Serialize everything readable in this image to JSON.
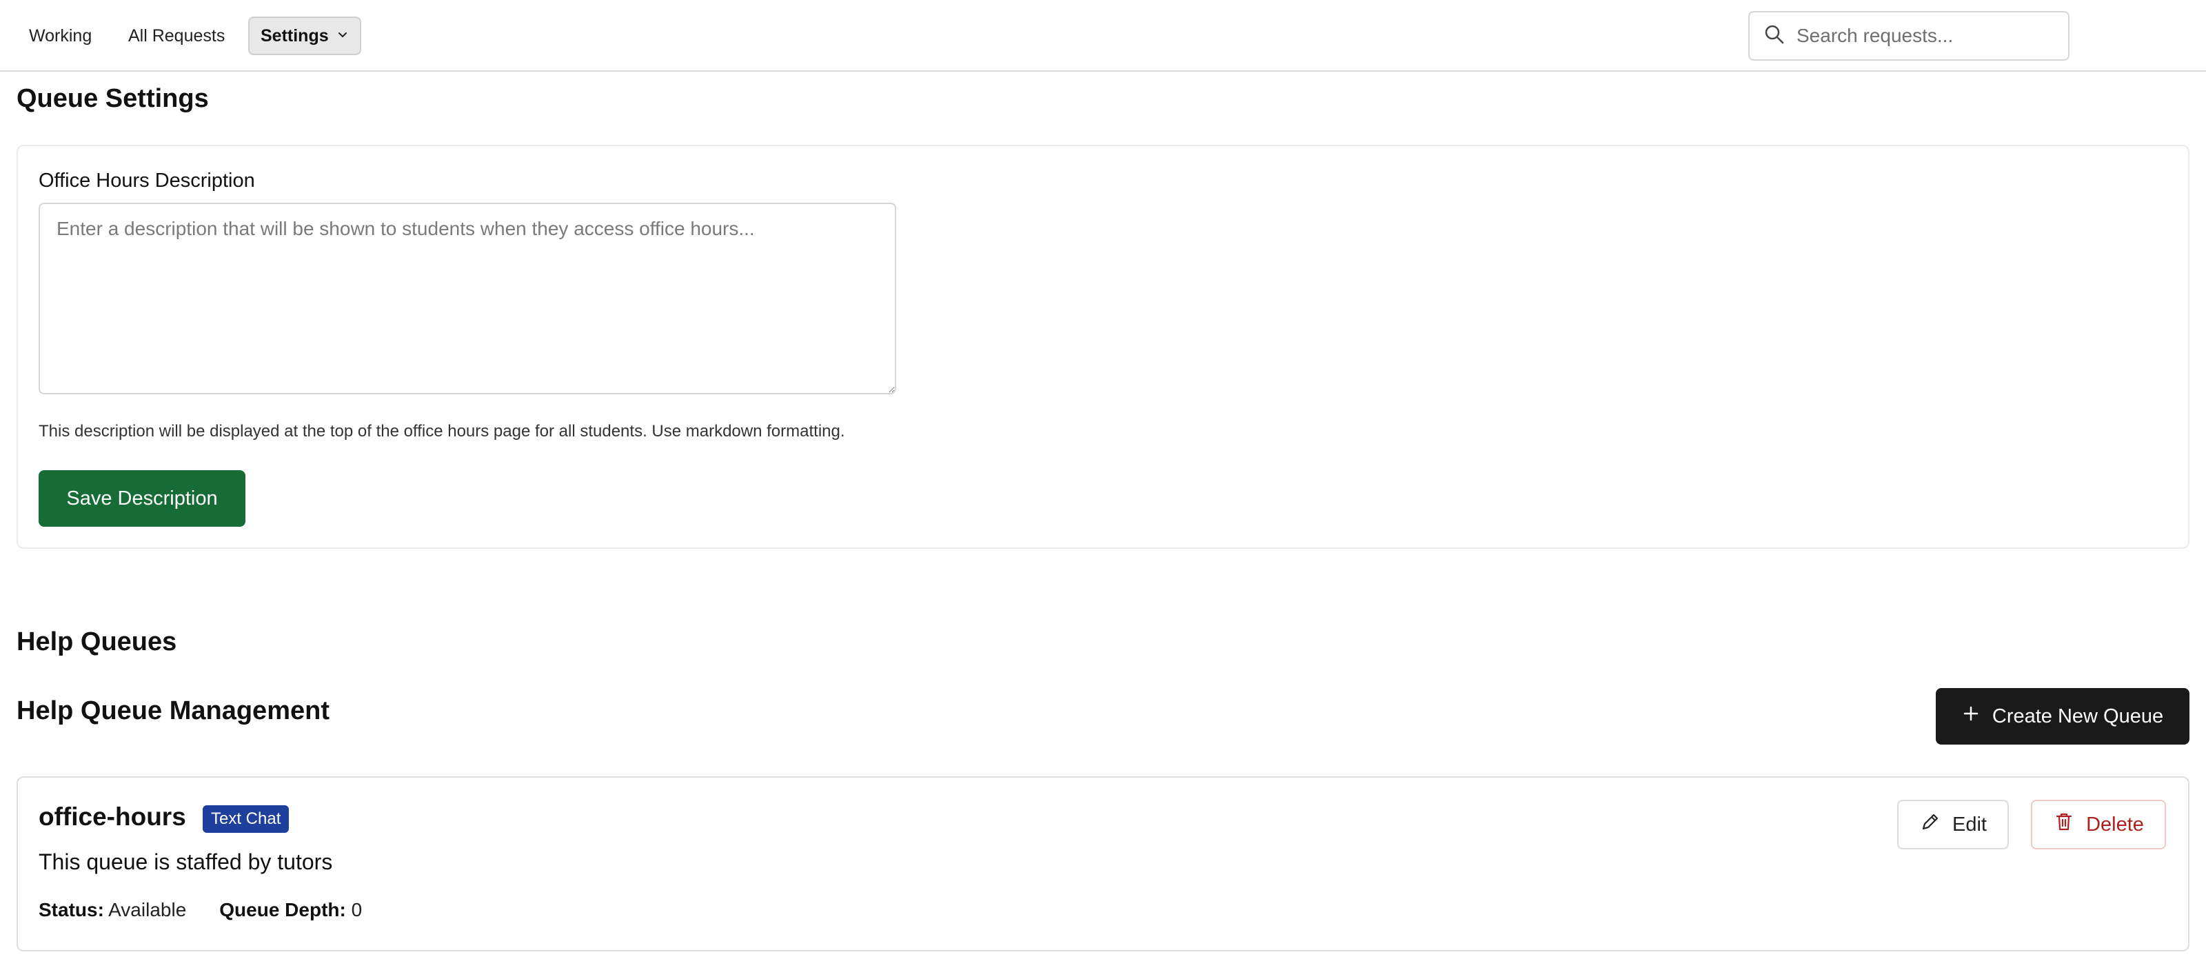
{
  "nav": {
    "items": [
      {
        "label": "Working"
      },
      {
        "label": "All Requests"
      },
      {
        "label": "Settings"
      }
    ],
    "search_placeholder": "Search requests..."
  },
  "queue_settings": {
    "title": "Queue Settings",
    "field_label": "Office Hours Description",
    "textarea_value": "",
    "textarea_placeholder": "Enter a description that will be shown to students when they access office hours...",
    "help_text": "This description will be displayed at the top of the office hours page for all students. Use markdown formatting.",
    "save_label": "Save Description"
  },
  "help_queues": {
    "title": "Help Queues",
    "management_title": "Help Queue Management",
    "create_label": "Create New Queue",
    "queues": [
      {
        "name": "office-hours",
        "badge": "Text Chat",
        "description": "This queue is staffed by tutors",
        "status_label": "Status:",
        "status_value": "Available",
        "depth_label": "Queue Depth:",
        "depth_value": "0",
        "edit_label": "Edit",
        "delete_label": "Delete"
      }
    ]
  },
  "icons": {
    "settings_chevron": "chevron-down-icon",
    "search": "search-icon",
    "create": "plus-icon",
    "edit": "pencil-icon",
    "delete": "trash-icon"
  },
  "colors": {
    "save_button": "#176b34",
    "create_button": "#1a1a1a",
    "badge": "#1f3f9c",
    "delete_text": "#b01f1f"
  }
}
